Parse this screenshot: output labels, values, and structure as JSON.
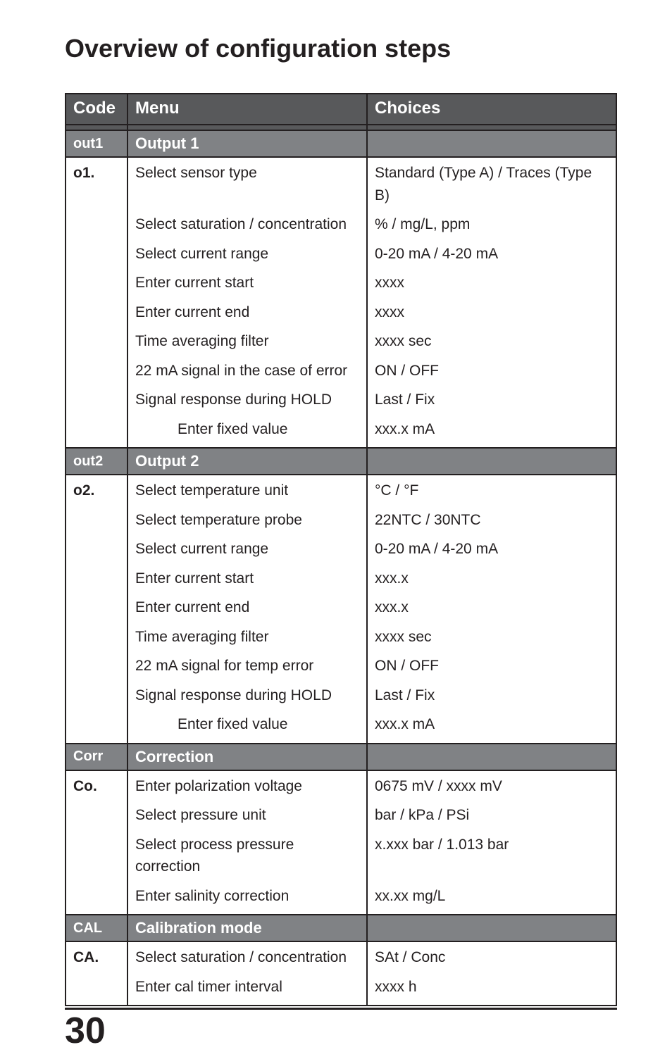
{
  "title": "Overview of configuration steps",
  "page_number": "30",
  "headers": {
    "code": "Code",
    "menu": "Menu",
    "choices": "Choices"
  },
  "sections": [
    {
      "code": "out1",
      "title": "Output 1",
      "subcode": "o1.",
      "rows": [
        {
          "menu": "Select sensor type",
          "choice": "Standard (Type A) / Traces (Type B)"
        },
        {
          "menu": "Select saturation / concentration",
          "choice": "% / mg/L, ppm"
        },
        {
          "menu": "Select current range",
          "choice": "0-20 mA / 4-20 mA"
        },
        {
          "menu": "Enter current start",
          "choice": "xxxx"
        },
        {
          "menu": "Enter current end",
          "choice": "xxxx"
        },
        {
          "menu": "Time averaging filter",
          "choice": "xxxx sec"
        },
        {
          "menu": "22 mA signal in the case of error",
          "choice": "ON / OFF"
        },
        {
          "menu": "Signal response during HOLD",
          "choice": "Last / Fix"
        },
        {
          "menu": "Enter fixed value",
          "choice": "xxx.x mA",
          "indent": true
        }
      ]
    },
    {
      "code": "out2",
      "title": "Output 2",
      "subcode": "o2.",
      "rows": [
        {
          "menu": "Select temperature unit",
          "choice": "°C / °F"
        },
        {
          "menu": "Select temperature probe",
          "choice": "22NTC / 30NTC"
        },
        {
          "menu": "Select current range",
          "choice": "0-20 mA / 4-20 mA"
        },
        {
          "menu": "Enter current start",
          "choice": "xxx.x"
        },
        {
          "menu": "Enter current end",
          "choice": "xxx.x"
        },
        {
          "menu": "Time averaging filter",
          "choice": "xxxx sec"
        },
        {
          "menu": "22 mA signal for temp error",
          "choice": "ON / OFF"
        },
        {
          "menu": "Signal response during HOLD",
          "choice": "Last / Fix"
        },
        {
          "menu": "Enter fixed value",
          "choice": "xxx.x mA",
          "indent": true
        }
      ]
    },
    {
      "code": "Corr",
      "title": "Correction",
      "subcode": "Co.",
      "rows": [
        {
          "menu": "Enter polarization voltage",
          "choice": "0675 mV / xxxx mV"
        },
        {
          "menu": "Select pressure unit",
          "choice": "bar / kPa / PSi"
        },
        {
          "menu": "Select process pressure correction",
          "choice": "x.xxx bar / 1.013 bar"
        },
        {
          "menu": "Enter salinity correction",
          "choice": "xx.xx mg/L"
        }
      ]
    },
    {
      "code": "CAL",
      "title": "Calibration mode",
      "subcode": "CA.",
      "rows": [
        {
          "menu": "Select saturation / concentration",
          "choice": "SAt / Conc"
        },
        {
          "menu": "Enter cal timer interval",
          "choice": "xxxx h"
        }
      ]
    }
  ]
}
